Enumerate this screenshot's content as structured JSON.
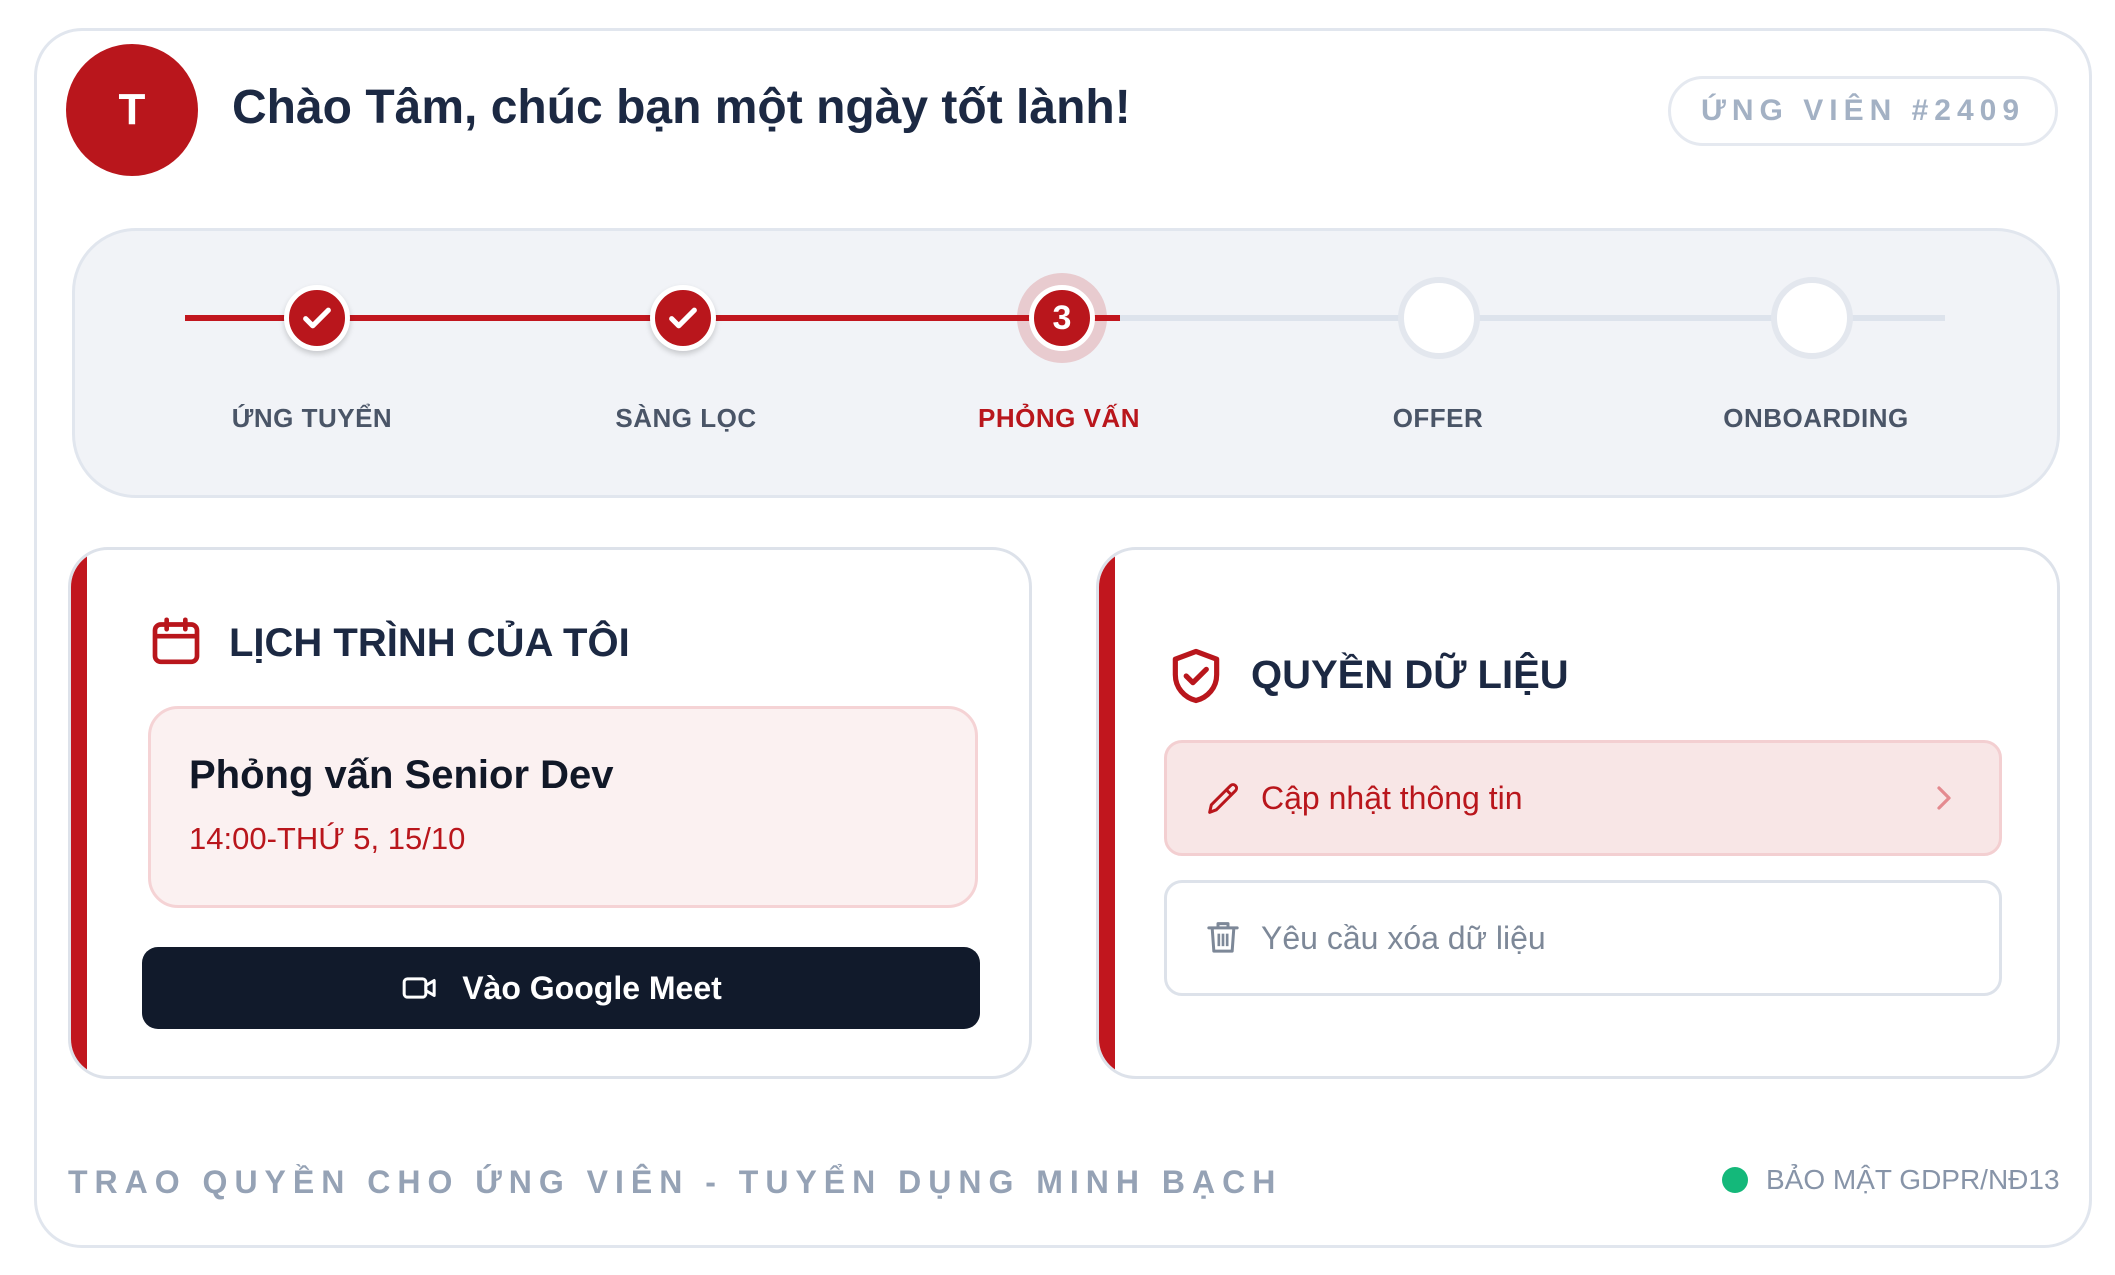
{
  "header": {
    "avatar_initial": "T",
    "greeting": "Chào Tâm, chúc bạn một ngày tốt lành!",
    "candidate_id": "ỨNG VIÊN #2409"
  },
  "progress": {
    "current_step": 3,
    "steps": [
      {
        "label": "ỨNG TUYỂN",
        "status": "done"
      },
      {
        "label": "SÀNG LỌC",
        "status": "done"
      },
      {
        "label": "PHỎNG VẤN",
        "status": "current",
        "number": "3"
      },
      {
        "label": "OFFER",
        "status": "todo"
      },
      {
        "label": "ONBOARDING",
        "status": "todo"
      }
    ]
  },
  "schedule": {
    "title": "LỊCH TRÌNH CỦA TÔI",
    "icon": "calendar-icon",
    "event": {
      "title": "Phỏng vấn Senior Dev",
      "time": "14:00-THỨ 5, 15/10"
    },
    "meet_button": {
      "label": "Vào Google Meet",
      "icon": "video-camera-icon"
    }
  },
  "data_rights": {
    "title": "QUYỀN DỮ LIỆU",
    "icon": "shield-check-icon",
    "actions": [
      {
        "label": "Cập nhật thông tin",
        "icon": "pencil-icon"
      },
      {
        "label": "Yêu cầu xóa dữ liệu",
        "icon": "trash-icon"
      }
    ]
  },
  "footer": {
    "tagline": "TRAO QUYỀN CHO ỨNG VIÊN - TUYỂN DỤNG MINH BẠCH",
    "security_label": "BẢO MẬT GDPR/NĐ13",
    "security_status_color": "#14b87a"
  },
  "colors": {
    "accent": "#b9161c",
    "dark_button": "#111a2b",
    "muted": "#95a2b5"
  }
}
